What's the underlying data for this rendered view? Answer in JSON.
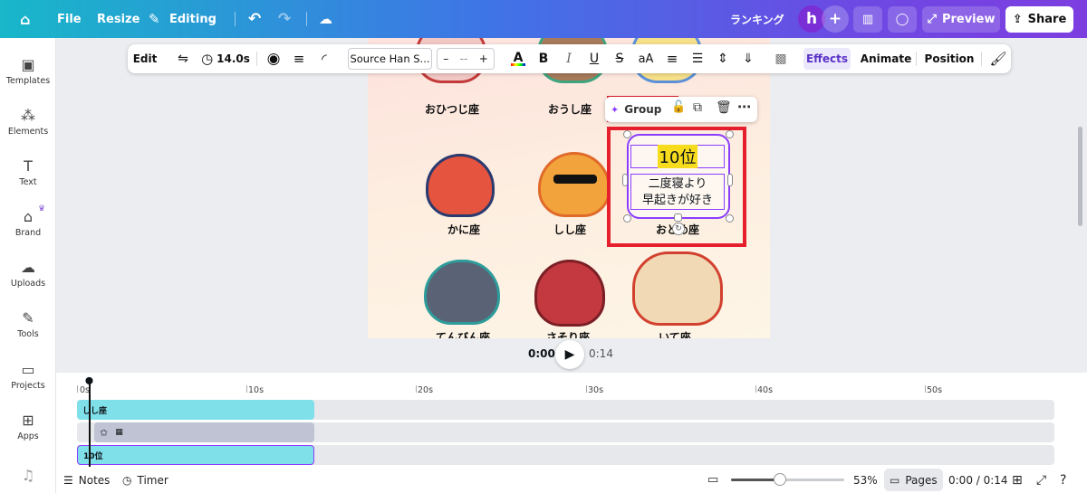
{
  "topbar": {
    "file": "File",
    "resize": "Resize",
    "editing": "Editing",
    "project_title": "ランキング",
    "avatar_letter": "h",
    "preview": "Preview",
    "share": "Share"
  },
  "sidebar": {
    "items": [
      {
        "label": "Templates",
        "icon": "templates-icon"
      },
      {
        "label": "Elements",
        "icon": "elements-icon"
      },
      {
        "label": "Text",
        "icon": "text-icon"
      },
      {
        "label": "Brand",
        "icon": "brand-icon"
      },
      {
        "label": "Uploads",
        "icon": "uploads-icon"
      },
      {
        "label": "Tools",
        "icon": "tools-icon"
      },
      {
        "label": "Projects",
        "icon": "projects-icon"
      },
      {
        "label": "Apps",
        "icon": "apps-icon"
      }
    ]
  },
  "toolbar": {
    "edit": "Edit",
    "duration": "14.0s",
    "font": "Source Han S...",
    "minus": "–",
    "size": "--",
    "plus": "+",
    "text_color_label": "A",
    "bold": "B",
    "italic": "I",
    "underline": "U",
    "strike": "S",
    "case": "aA",
    "effects": "Effects",
    "animate": "Animate",
    "position": "Position"
  },
  "canvas": {
    "labels_row1": [
      "おひつじ座",
      "おうし座"
    ],
    "labels_row2": [
      "かに座",
      "しし座",
      "おとめ座"
    ],
    "labels_row3": [
      "てんびん座",
      "さそり座",
      "いて座"
    ],
    "rank_text": "10位",
    "desc_line1": "二度寝より",
    "desc_line2": "早起きが好き"
  },
  "context_menu": {
    "group": "Group"
  },
  "playback": {
    "current": "0:00",
    "total": "0:14"
  },
  "timeline": {
    "ticks": [
      "0s",
      "10s",
      "20s",
      "30s",
      "40s",
      "50s"
    ],
    "clips": [
      {
        "label": "しし座",
        "color": "#7fe0ea"
      },
      {
        "label": "",
        "color": "#bfc3d3"
      },
      {
        "label": "10位",
        "color": "#7fe0ea"
      }
    ]
  },
  "bottombar": {
    "notes": "Notes",
    "timer": "Timer",
    "zoom": "53%",
    "pages": "Pages",
    "time": "0:00 / 0:14"
  },
  "colors": {
    "accent_purple": "#7d3ee0",
    "accent_teal": "#18b7c9",
    "highlight_red": "#e5202c",
    "rank_yellow": "#f7dc1e"
  }
}
